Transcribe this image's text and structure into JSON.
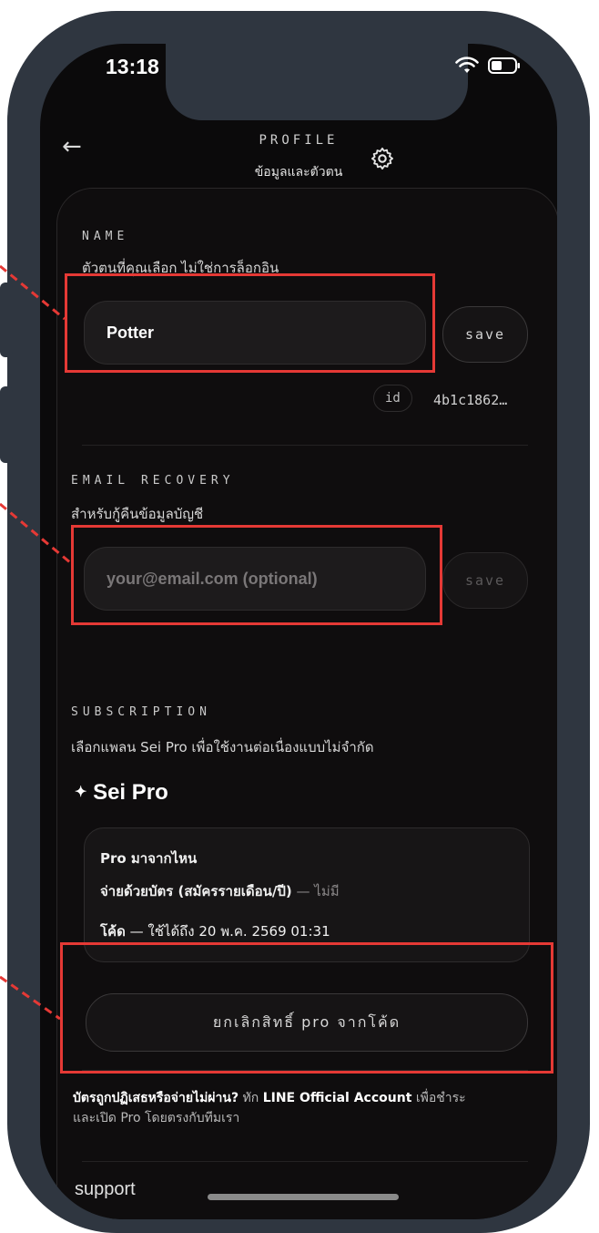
{
  "status_bar": {
    "time": "13:18"
  },
  "header": {
    "title": "PROFILE",
    "subtitle": "ข้อมูลและตัวตน"
  },
  "name_section": {
    "label": "NAME",
    "hint": "ตัวตนที่คุณเลือก ไม่ใช่การล็อกอิน",
    "value": "Potter",
    "save_label": "save",
    "id_label": "id",
    "id_value": "4b1c1862…"
  },
  "email_section": {
    "label": "EMAIL RECOVERY",
    "hint": "สำหรับกู้คืนข้อมูลบัญชี",
    "placeholder": "your@email.com (optional)",
    "save_label": "save"
  },
  "subscription_section": {
    "label": "SUBSCRIPTION",
    "hint": "เลือกแพลน Sei Pro เพื่อใช้งานต่อเนื่องแบบไม่จำกัด",
    "plan_name": "Sei Pro",
    "box_title": "Pro มาจากไหน",
    "card_line": "จ่ายด้วยบัตร (สมัครรายเดือน/ปี)",
    "card_status": "— ไม่มี",
    "code_line_prefix": "โค้ด",
    "code_line_rest": "— ใช้ได้ถึง 20 พ.ค. 2569 01:31",
    "cancel_label": "ยกเลิกสิทธิ์ pro จากโค้ด"
  },
  "payment_note": {
    "bold_part": "บัตรถูกปฏิเสธหรือจ่ายไม่ผ่าน?",
    "middle_part": "ทัก",
    "link_part": "LINE Official Account",
    "end_part": "เพื่อชำระ",
    "line2": "และเปิด Pro โดยตรงกับทีมเรา"
  },
  "footer": {
    "support_label": "support"
  },
  "colors": {
    "highlight": "#e53935",
    "frame": "#2f3640",
    "background": "#0b0a0b"
  }
}
